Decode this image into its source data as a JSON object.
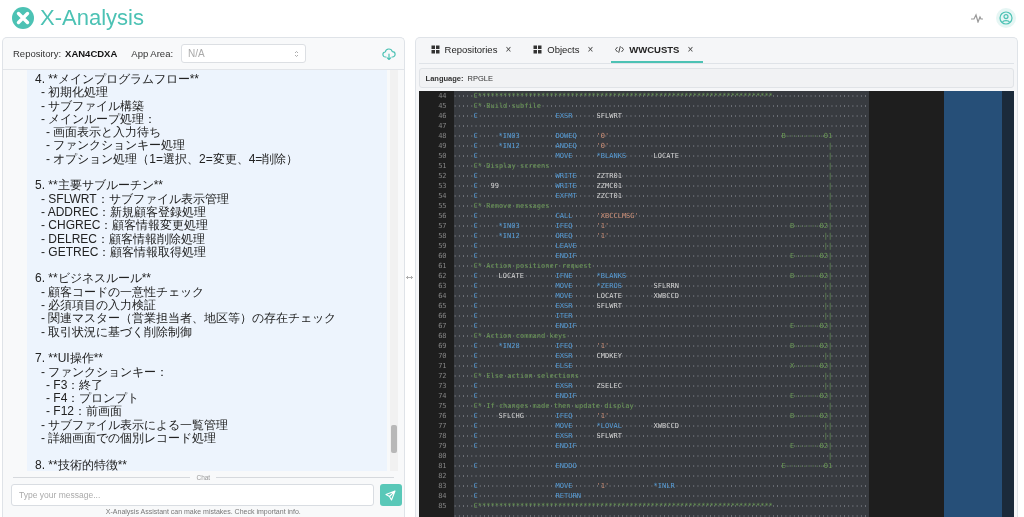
{
  "app": {
    "title": "X-Analysis"
  },
  "repository": {
    "label": "Repository:",
    "value": "XAN4CDXA",
    "app_area_label": "App Area:",
    "app_area_placeholder": "N/A"
  },
  "chat": {
    "sections": [
      {
        "heading": "4. **メインプログラムフロー**",
        "items": [
          {
            "text": "- 初期化処理"
          },
          {
            "text": "- サブファイル構築"
          },
          {
            "text": "- メインループ処理：",
            "children": [
              {
                "text": "- 画面表示と入力待ち"
              },
              {
                "text": "- ファンクションキー処理"
              },
              {
                "text": "- オプション処理（1=選択、2=変更、4=削除）"
              }
            ]
          }
        ]
      },
      {
        "heading": "5. **主要サブルーチン**",
        "items": [
          {
            "text": "- SFLWRT：サブファイル表示管理"
          },
          {
            "text": "- ADDREC：新規顧客登録処理"
          },
          {
            "text": "- CHGREC：顧客情報変更処理"
          },
          {
            "text": "- DELREC：顧客情報削除処理"
          },
          {
            "text": "- GETREC：顧客情報取得処理"
          }
        ]
      },
      {
        "heading": "6. **ビジネスルール**",
        "items": [
          {
            "text": "- 顧客コードの一意性チェック"
          },
          {
            "text": "- 必須項目の入力検証"
          },
          {
            "text": "- 関連マスター（営業担当者、地区等）の存在チェック"
          },
          {
            "text": "- 取引状況に基づく削除制御"
          }
        ]
      },
      {
        "heading": "7. **UI操作**",
        "items": [
          {
            "text": "- ファンクションキー：",
            "children": [
              {
                "text": "- F3：終了"
              },
              {
                "text": "- F4：プロンプト"
              },
              {
                "text": "- F12：前画面"
              }
            ]
          },
          {
            "text": "- サブファイル表示による一覧管理"
          },
          {
            "text": "- 詳細画面での個別レコード処理"
          }
        ]
      },
      {
        "heading": "8. **技術的特徴**"
      }
    ],
    "divider": "Chat",
    "input": {
      "placeholder": "Type your message..."
    },
    "disclaimer": "X-Analysis Assistant can make mistakes. Check important info."
  },
  "tabs": [
    {
      "label": "Repositories",
      "kind": "grid",
      "close": "×",
      "selected": false
    },
    {
      "label": "Objects",
      "kind": "grid",
      "close": "×",
      "selected": false
    },
    {
      "label": "WWCUSTS",
      "kind": "code",
      "close": "×",
      "selected": true
    }
  ],
  "language": {
    "label": "Language:",
    "value": "RPGLE"
  },
  "code_lines": [
    {
      "num": "44",
      "kind": "comment",
      "text": "C**********************************************************************"
    },
    {
      "num": "45",
      "kind": "comment",
      "text": "C* Build subfile"
    },
    {
      "num": "46",
      "kind": "code",
      "spec": "C",
      "opcode": "EXSR",
      "factor2": "SFLWRT"
    },
    {
      "num": "47",
      "kind": "blank"
    },
    {
      "num": "48",
      "kind": "code",
      "spec": "C",
      "factor1": "*IN03",
      "opcode": "DOWEQ",
      "factor2": "'0'",
      "nest": "B---------01"
    },
    {
      "num": "49",
      "kind": "code",
      "spec": "C",
      "factor1": "*IN12",
      "opcode": "ANDEQ",
      "factor2": "'0'",
      "nest": "           |"
    },
    {
      "num": "50",
      "kind": "code",
      "spec": "C",
      "opcode": "MOVE",
      "factor2": "*BLANKS",
      "result": "LOCATE",
      "nest": "           |"
    },
    {
      "num": "51",
      "kind": "comment",
      "text": "C* Display screens",
      "nest": "           |"
    },
    {
      "num": "52",
      "kind": "code",
      "spec": "C",
      "opcode": "WRITE",
      "factor2": "ZZTR01",
      "nest": "           |"
    },
    {
      "num": "53",
      "kind": "code",
      "spec": "C",
      "n01": "99",
      "opcode": "WRITE",
      "factor2": "ZZMC01",
      "nest": "           |"
    },
    {
      "num": "54",
      "kind": "code",
      "spec": "C",
      "opcode": "EXFMT",
      "factor2": "ZZCT01",
      "nest": "           |"
    },
    {
      "num": "55",
      "kind": "comment",
      "text": "C* Remove messages",
      "nest": "           |"
    },
    {
      "num": "56",
      "kind": "code",
      "spec": "C",
      "opcode": "CALL",
      "factor2": "'XBCCLMSG'",
      "nest": "           |"
    },
    {
      "num": "57",
      "kind": "code",
      "spec": "C",
      "factor1": "*IN03",
      "opcode": "IFEQ",
      "factor2": "'1'",
      "nest": "  B------02|"
    },
    {
      "num": "58",
      "kind": "code",
      "spec": "C",
      "factor1": "*IN12",
      "opcode": "OREQ",
      "factor2": "'1'",
      "nest": "          ||"
    },
    {
      "num": "59",
      "kind": "code",
      "spec": "C",
      "opcode": "LEAVE",
      "nest": "          ||"
    },
    {
      "num": "60",
      "kind": "code",
      "spec": "C",
      "opcode": "ENDIF",
      "nest": "  E------02|"
    },
    {
      "num": "61",
      "kind": "comment",
      "text": "C* Action positioner request",
      "nest": "           |"
    },
    {
      "num": "62",
      "kind": "code",
      "spec": "C",
      "factor1": "LOCATE",
      "opcode": "IFNE",
      "factor2": "*BLANKS",
      "nest": "  B------02|"
    },
    {
      "num": "63",
      "kind": "code",
      "spec": "C",
      "opcode": "MOVE",
      "factor2": "*ZEROS",
      "result": "SFLRRN",
      "nest": "          ||"
    },
    {
      "num": "64",
      "kind": "code",
      "spec": "C",
      "opcode": "MOVE",
      "factor2": "LOCATE",
      "result": "XWBCCD",
      "nest": "          ||"
    },
    {
      "num": "65",
      "kind": "code",
      "spec": "C",
      "opcode": "EXSR",
      "factor2": "SFLWRT",
      "nest": "          ||"
    },
    {
      "num": "66",
      "kind": "code",
      "spec": "C",
      "opcode": "ITER",
      "nest": "          ||"
    },
    {
      "num": "67",
      "kind": "code",
      "spec": "C",
      "opcode": "ENDIF",
      "nest": "  E------02|"
    },
    {
      "num": "68",
      "kind": "comment",
      "text": "C* Action command keys",
      "nest": "           |"
    },
    {
      "num": "69",
      "kind": "code",
      "spec": "C",
      "factor1": "*IN28",
      "opcode": "IFEQ",
      "factor2": "'1'",
      "nest": "  B------02|"
    },
    {
      "num": "70",
      "kind": "code",
      "spec": "C",
      "opcode": "EXSR",
      "factor2": "CMDKEY",
      "nest": "          ||"
    },
    {
      "num": "71",
      "kind": "code",
      "spec": "C",
      "opcode": "ELSE",
      "nest": "  X------02|"
    },
    {
      "num": "72",
      "kind": "comment",
      "text": "C* Else action selections",
      "nest": "          ||"
    },
    {
      "num": "73",
      "kind": "code",
      "spec": "C",
      "opcode": "EXSR",
      "factor2": "ZSELEC",
      "nest": "          ||"
    },
    {
      "num": "74",
      "kind": "code",
      "spec": "C",
      "opcode": "ENDIF",
      "nest": "  E------02|"
    },
    {
      "num": "75",
      "kind": "comment",
      "text": "C* If changes made then update display",
      "nest": "           |"
    },
    {
      "num": "76",
      "kind": "code",
      "spec": "C",
      "factor1": "SFLCHG",
      "opcode": "IFEQ",
      "factor2": "'1'",
      "nest": "  B------02|"
    },
    {
      "num": "77",
      "kind": "code",
      "spec": "C",
      "opcode": "MOVE",
      "factor2": "*LOVAL",
      "result": "XWBCCD",
      "nest": "          ||"
    },
    {
      "num": "78",
      "kind": "code",
      "spec": "C",
      "opcode": "EXSR",
      "factor2": "SFLWRT",
      "nest": "          ||"
    },
    {
      "num": "79",
      "kind": "code",
      "spec": "C",
      "opcode": "ENDIF",
      "nest": "  E------02|"
    },
    {
      "num": "80",
      "kind": "blank",
      "nest": "           |"
    },
    {
      "num": "81",
      "kind": "code",
      "spec": "C",
      "opcode": "ENDDO",
      "nest": "E---------01"
    },
    {
      "num": "82",
      "kind": "blank"
    },
    {
      "num": "83",
      "kind": "code",
      "spec": "C",
      "opcode": "MOVE",
      "factor2": "'1'",
      "result": "*INLR"
    },
    {
      "num": "84",
      "kind": "code",
      "spec": "C",
      "opcode": "RETURN"
    },
    {
      "num": "85",
      "kind": "comment",
      "text": "C**********************************************************************"
    }
  ]
}
